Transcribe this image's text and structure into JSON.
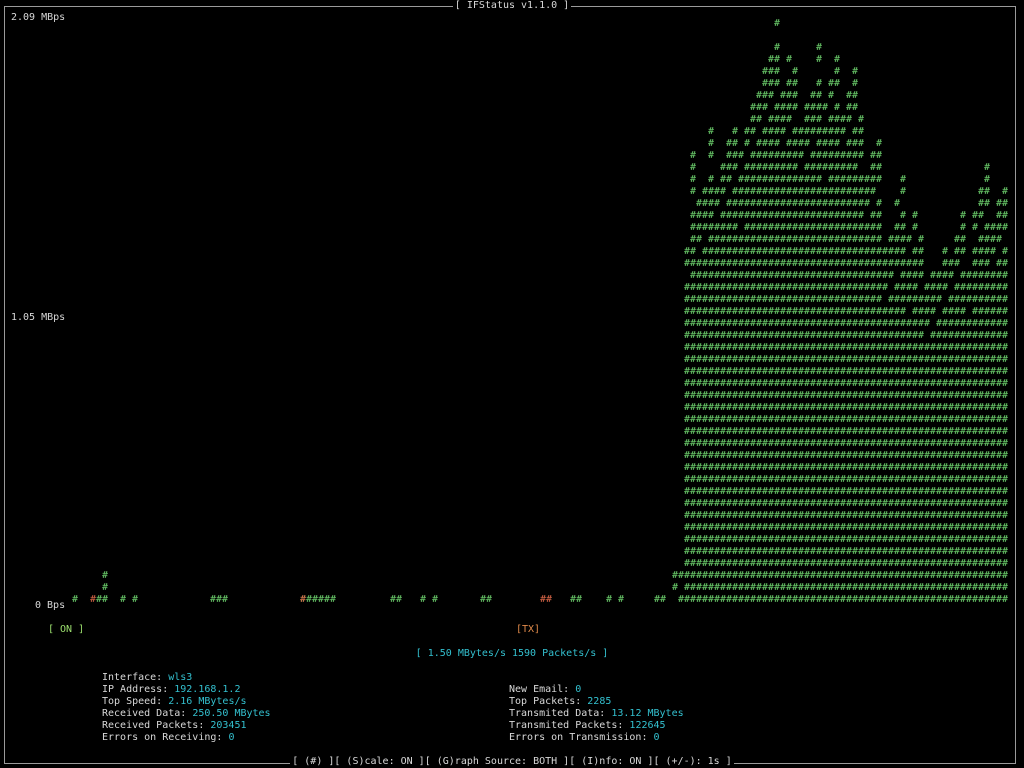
{
  "title": "[ IFStatus v1.1.0 ]",
  "graph": {
    "y_top_label": "2.09 MBps",
    "y_mid_label": "1.05 MBps",
    "y_bottom_label": "0 Bps",
    "scale_top_mbps": 2.09,
    "colors": {
      "rx": "#6ed36e",
      "tx": "#e06a4a"
    }
  },
  "indicator": {
    "on_label": "[ ON ]",
    "source_label": "[TX]"
  },
  "rate_line": "[ 1.50 MBytes/s  1590 Packets/s ]",
  "info_left": [
    {
      "key": "Interface: ",
      "value": "wls3"
    },
    {
      "key": "IP Address: ",
      "value": "192.168.1.2"
    },
    {
      "key": "Top Speed: ",
      "value": "2.16 MBytes/s"
    },
    {
      "key": "Received Data: ",
      "value": "250.50 MBytes"
    },
    {
      "key": "Received Packets: ",
      "value": "203451"
    },
    {
      "key": "Errors on Receiving: ",
      "value": "0"
    }
  ],
  "info_right": [
    {
      "key": "New Email: ",
      "value": "0"
    },
    {
      "key": "Top Packets: ",
      "value": "2285"
    },
    {
      "key": "Transmited Data: ",
      "value": "13.12 MBytes"
    },
    {
      "key": "Transmited Packets: ",
      "value": "122645"
    },
    {
      "key": "Errors on Transmission: ",
      "value": "0"
    }
  ],
  "footer": "[ (#) ][ (S)cale: ON ][ (G)raph Source: BOTH ][ (I)nfo: ON ][ (+/-): 1s ]"
}
